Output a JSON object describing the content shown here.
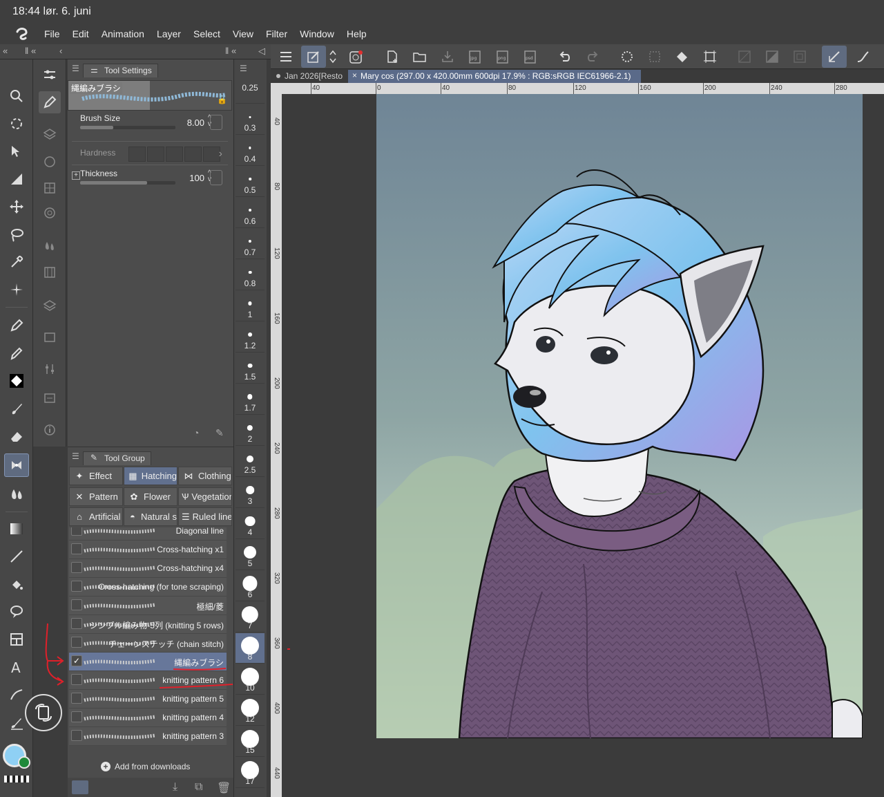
{
  "status": {
    "time_date": "18:44  lør. 6. juni"
  },
  "menu": [
    "File",
    "Edit",
    "Animation",
    "Layer",
    "Select",
    "View",
    "Filter",
    "Window",
    "Help"
  ],
  "tool_settings": {
    "tab": "Tool Settings",
    "brush_name": "縄編みブラシ",
    "props": [
      {
        "label": "Brush Size",
        "value": "8.00",
        "fill": 0.35
      },
      {
        "label": "Hardness",
        "value": "",
        "fill": 0
      },
      {
        "label": "Thickness",
        "value": "100",
        "fill": 0.7
      }
    ]
  },
  "tool_group": {
    "tab": "Tool Group",
    "groups": [
      "Effect",
      "Hatching",
      "Clothing",
      "Pattern",
      "Flower",
      "Vegetation",
      "Artificial",
      "Natural s",
      "Ruled line"
    ],
    "active_group": "Hatching",
    "brushes": [
      {
        "name": "Diagonal line",
        "active": false
      },
      {
        "name": "Cross-hatching x1",
        "active": false
      },
      {
        "name": "Cross-hatching x4",
        "active": false
      },
      {
        "name": "Cross-hatching (for tone scraping)",
        "active": false
      },
      {
        "name": "極細/菱",
        "active": false
      },
      {
        "name": "シンプル編み物-5列 (knitting 5 rows)",
        "active": false
      },
      {
        "name": "チェーンステッチ (chain stitch)",
        "active": false
      },
      {
        "name": "縄編みブラシ",
        "active": true
      },
      {
        "name": "knitting pattern 6",
        "active": false
      },
      {
        "name": "knitting pattern 5",
        "active": false
      },
      {
        "name": "knitting pattern 4",
        "active": false
      },
      {
        "name": "knitting pattern 3",
        "active": false
      }
    ],
    "add_label": "Add from downloads"
  },
  "brush_sizes": [
    "0.25",
    "0.3",
    "0.4",
    "0.5",
    "0.6",
    "0.7",
    "0.8",
    "1",
    "1.2",
    "1.5",
    "1.7",
    "2",
    "2.5",
    "3",
    "4",
    "5",
    "6",
    "7",
    "8",
    "10",
    "12",
    "15",
    "17"
  ],
  "active_size": "8",
  "tabs": [
    {
      "label": "Jan 2026[Resto",
      "active": false
    },
    {
      "label": "Mary cos (297.00 x 420.00mm 600dpi 17.9% : RGB:sRGB IEC61966-2.1)",
      "active": true
    }
  ],
  "ruler_h": [
    "40",
    "0",
    "40",
    "80",
    "120",
    "160",
    "200",
    "240",
    "280"
  ],
  "ruler_v": [
    "40",
    "80",
    "120",
    "160",
    "200",
    "240",
    "280",
    "320",
    "360",
    "400",
    "440"
  ],
  "colors": {
    "accent": "#61708e",
    "sweater": "#6e5577",
    "hair": "#8ec6f0",
    "sky_top": "#6f8596",
    "sky_bottom": "#d6e6d6"
  }
}
